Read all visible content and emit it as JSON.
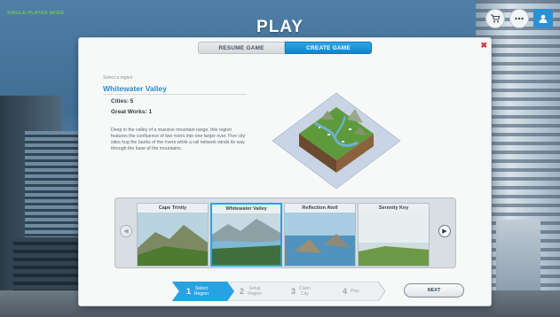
{
  "header": {
    "mode_label": "SINGLE-PLAYER MODE",
    "title": "PLAY"
  },
  "top_icons": [
    {
      "icon": "shop-cart-icon"
    },
    {
      "icon": "more-dots-icon"
    },
    {
      "icon": "user-profile-icon"
    }
  ],
  "tabs": {
    "resume": "RESUME GAME",
    "create": "CREATE GAME",
    "active": "create"
  },
  "region": {
    "hint": "Select a region",
    "name": "Whitewater Valley",
    "cities": "Cities: 5",
    "great_works": "Great Works: 1",
    "description": "Deep in the valley of a massive mountain range, this region features the confluence of two rivers into one larger river. Five city sites hug the banks of the rivers while a rail network winds its way through the base of the mountains."
  },
  "regions": [
    {
      "name": "Cape Trinity",
      "selected": false
    },
    {
      "name": "Whitewater Valley",
      "selected": true
    },
    {
      "name": "Reflection Atoll",
      "selected": false
    },
    {
      "name": "Serenity Key",
      "selected": false
    }
  ],
  "steps": [
    {
      "num": "1",
      "label_1": "Select",
      "label_2": "Region",
      "active": true
    },
    {
      "num": "2",
      "label_1": "Setup",
      "label_2": "Region",
      "active": false
    },
    {
      "num": "3",
      "label_1": "Claim",
      "label_2": "City",
      "active": false
    },
    {
      "num": "4",
      "label_1": "Play",
      "label_2": "",
      "active": false
    }
  ],
  "next_label": "NEXT",
  "colors": {
    "accent": "#27a3e3",
    "close": "#d03a3a",
    "mode_label": "#7fe04a"
  }
}
